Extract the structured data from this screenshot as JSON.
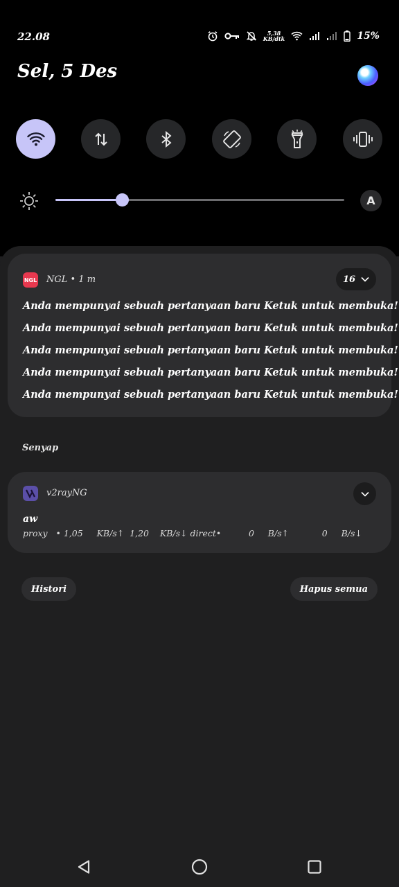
{
  "status_bar": {
    "time": "22.08",
    "net_speed_value": "5,38",
    "net_speed_unit": "KB/dtk",
    "battery_percent": "15%",
    "icons": [
      "alarm-icon",
      "vpn-key-icon",
      "mute-icon",
      "wifi-icon",
      "signal-icon",
      "signal-weak-icon",
      "battery-icon"
    ]
  },
  "header": {
    "date": "Sel, 5 Des"
  },
  "quick_settings": {
    "tiles": [
      {
        "name": "wifi",
        "icon": "wifi-icon",
        "active": true
      },
      {
        "name": "mobile-data",
        "icon": "data-arrows-icon",
        "active": false
      },
      {
        "name": "bluetooth",
        "icon": "bluetooth-icon",
        "active": false
      },
      {
        "name": "auto-rotate",
        "icon": "rotate-icon",
        "active": false
      },
      {
        "name": "flashlight",
        "icon": "flashlight-icon",
        "active": false
      },
      {
        "name": "vibrate",
        "icon": "vibrate-icon",
        "active": false
      }
    ],
    "brightness_level": 0.23,
    "auto_brightness_label": "A"
  },
  "notifications": {
    "ngl": {
      "icon_text": "NGL",
      "app_meta": "NGL • 1 m",
      "count": "16",
      "lines": [
        "Anda mempunyai sebuah pertanyaan baru  Ketuk untuk membuka!",
        "Anda mempunyai sebuah pertanyaan baru  Ketuk untuk membuka!",
        "Anda mempunyai sebuah pertanyaan baru  Ketuk untuk membuka!",
        "Anda mempunyai sebuah pertanyaan baru  Ketuk untuk membuka!",
        "Anda mempunyai sebuah pertanyaan baru  Ketuk untuk membuka!"
      ]
    },
    "silent_section": "Senyap",
    "v2ray": {
      "app_name": "v2rayNG",
      "title": "aw",
      "detail": "proxy   • 1,05     KB/s↑  1,20    KB/s↓ direct•          0     B/s↑            0     B/s↓"
    }
  },
  "actions": {
    "history": "Histori",
    "clear_all": "Hapus semua"
  },
  "colors": {
    "accent": "#c7c5f8",
    "background": "#1f1f20",
    "card": "#2d2d2f",
    "ngl_icon": "#e8384f",
    "v2ray_icon": "#5b4fa8"
  }
}
